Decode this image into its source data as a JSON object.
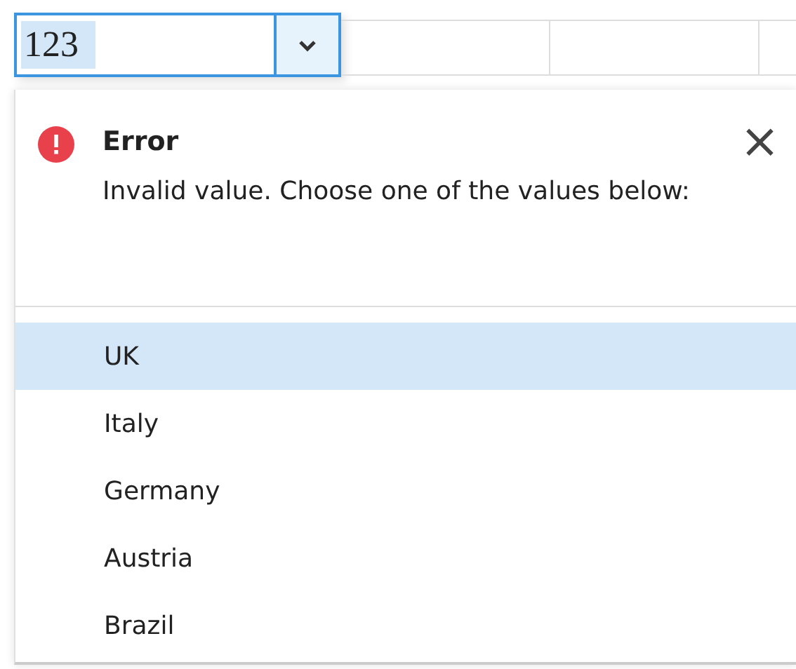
{
  "cell": {
    "value": "123",
    "selected_text": true
  },
  "error": {
    "title": "Error",
    "message": "Invalid value. Choose one of the values below:",
    "close": "×"
  },
  "options": [
    {
      "label": "UK",
      "selected": true
    },
    {
      "label": "Italy",
      "selected": false
    },
    {
      "label": "Germany",
      "selected": false
    },
    {
      "label": "Austria",
      "selected": false
    },
    {
      "label": "Brazil",
      "selected": false
    }
  ]
}
